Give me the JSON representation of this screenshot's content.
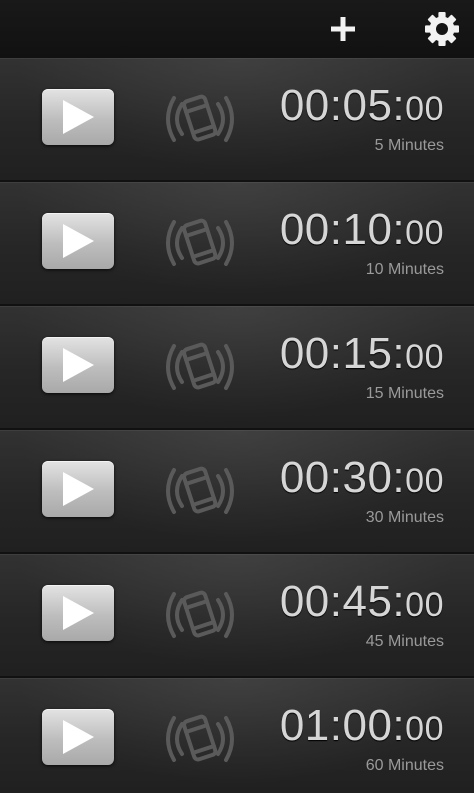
{
  "actionbar": {
    "add_icon": "plus-icon",
    "settings_icon": "gear-icon"
  },
  "colors": {
    "background": "#1e1e1e",
    "button": "#c8c8c8",
    "time_text": "#d6d6d6",
    "subtitle_text": "#9a9a9a",
    "vibrate_icon": "#5a5a5a"
  },
  "timers": [
    {
      "time_main": "00:05:",
      "time_ms": "00",
      "label": "5 Minutes",
      "play_icon": "play-icon",
      "vibrate_icon": "vibrate-icon"
    },
    {
      "time_main": "00:10:",
      "time_ms": "00",
      "label": "10 Minutes",
      "play_icon": "play-icon",
      "vibrate_icon": "vibrate-icon"
    },
    {
      "time_main": "00:15:",
      "time_ms": "00",
      "label": "15 Minutes",
      "play_icon": "play-icon",
      "vibrate_icon": "vibrate-icon"
    },
    {
      "time_main": "00:30:",
      "time_ms": "00",
      "label": "30 Minutes",
      "play_icon": "play-icon",
      "vibrate_icon": "vibrate-icon"
    },
    {
      "time_main": "00:45:",
      "time_ms": "00",
      "label": "45 Minutes",
      "play_icon": "play-icon",
      "vibrate_icon": "vibrate-icon"
    },
    {
      "time_main": "01:00:",
      "time_ms": "00",
      "label": "60 Minutes",
      "play_icon": "play-icon",
      "vibrate_icon": "vibrate-icon"
    }
  ]
}
